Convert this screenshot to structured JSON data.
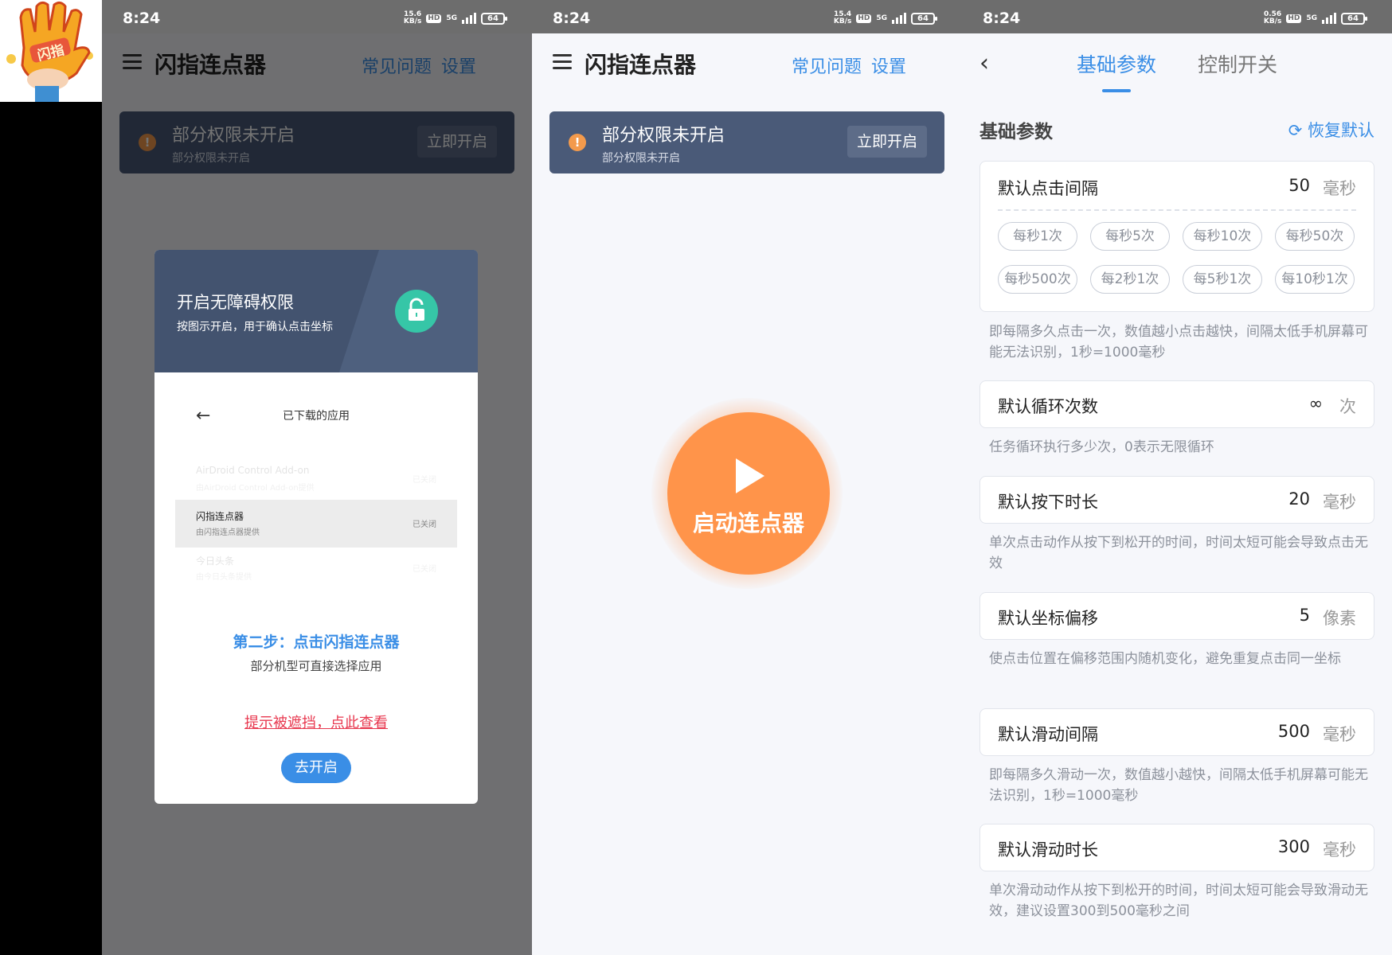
{
  "logo": {
    "text": "闪指"
  },
  "status": {
    "p1": {
      "time": "8:24",
      "speed": "15.6",
      "speed_unit": "KB/s",
      "hd": "HD",
      "net": "5G",
      "battery": "64"
    },
    "p2": {
      "time": "8:24",
      "speed": "15.4",
      "speed_unit": "KB/s",
      "hd": "HD",
      "net": "5G",
      "battery": "64"
    },
    "p3": {
      "time": "8:24",
      "speed": "0.56",
      "speed_unit": "KB/s",
      "hd": "HD",
      "net": "5G",
      "battery": "64"
    }
  },
  "app": {
    "title": "闪指连点器",
    "faq": "常见问题",
    "settings": "设置",
    "banner_title": "部分权限未开启",
    "banner_sub": "部分权限未开启",
    "banner_btn": "立即开启",
    "warn_glyph": "!"
  },
  "dialog": {
    "head_title": "开启无障碍权限",
    "head_sub": "按图示开启，用于确认点击坐标",
    "back_glyph": "←",
    "list_title": "已下载的应用",
    "rows": [
      {
        "name": "AirDroid Control Add-on",
        "sub": "由AirDroid Control Add-on提供",
        "state": "已关闭"
      },
      {
        "name": "闪指连点器",
        "sub": "由闪指连点器提供",
        "state": "已关闭"
      },
      {
        "name": "今日头条",
        "sub": "由今日头条提供",
        "state": "已关闭"
      }
    ],
    "step": "第二步：点击闪指连点器",
    "step_sub": "部分机型可直接选择应用",
    "hint": "提示被遮挡，点此查看",
    "go_btn": "去开启"
  },
  "start": {
    "label": "启动连点器"
  },
  "settings_page": {
    "back_glyph": "‹",
    "tab_basic": "基础参数",
    "tab_control": "控制开关",
    "section_title": "基础参数",
    "restore": "恢复默认",
    "click_interval": {
      "label": "默认点击间隔",
      "value": "50",
      "unit": "毫秒",
      "chips": [
        "每秒1次",
        "每秒5次",
        "每秒10次",
        "每秒50次",
        "每秒500次",
        "每2秒1次",
        "每5秒1次",
        "每10秒1次"
      ],
      "desc": "即每隔多久点击一次，数值越小点击越快，间隔太低手机屏幕可能无法识别，1秒=1000毫秒"
    },
    "loop_count": {
      "label": "默认循环次数",
      "value": "∞",
      "unit": "次",
      "desc": "任务循环执行多少次，0表示无限循环"
    },
    "press_duration": {
      "label": "默认按下时长",
      "value": "20",
      "unit": "毫秒",
      "desc": "单次点击动作从按下到松开的时间，时间太短可能会导致点击无效"
    },
    "offset": {
      "label": "默认坐标偏移",
      "value": "5",
      "unit": "像素",
      "desc": "使点击位置在偏移范围内随机变化，避免重复点击同一坐标"
    },
    "swipe_interval": {
      "label": "默认滑动间隔",
      "value": "500",
      "unit": "毫秒",
      "desc": "即每隔多久滑动一次，数值越小越快，间隔太低手机屏幕可能无法识别，1秒=1000毫秒"
    },
    "swipe_duration": {
      "label": "默认滑动时长",
      "value": "300",
      "unit": "毫秒",
      "desc": "单次滑动动作从按下到松开的时间，时间太短可能会导致滑动无效，建议设置300到500毫秒之间"
    }
  },
  "colors": {
    "accent": "#3a8ee6",
    "orange": "#ff944a",
    "banner": "#4a5a78",
    "link_red": "#e8384f"
  }
}
